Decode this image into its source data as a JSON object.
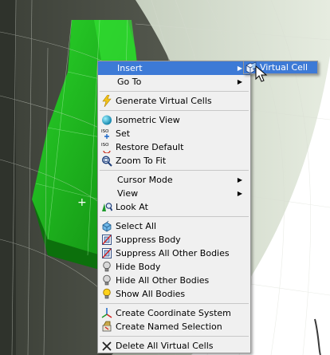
{
  "menu": {
    "items": [
      {
        "label": "Insert",
        "submenu": true,
        "highlighted": true
      },
      {
        "label": "Go To",
        "submenu": true
      },
      {
        "separator": true
      },
      {
        "label": "Generate Virtual Cells",
        "icon": "lightning-icon"
      },
      {
        "separator": true
      },
      {
        "label": "Isometric View",
        "icon": "sphere-icon"
      },
      {
        "label": "Set",
        "icon": "iso-set-icon"
      },
      {
        "label": "Restore Default",
        "icon": "iso-restore-icon"
      },
      {
        "label": "Zoom To Fit",
        "icon": "zoom-fit-icon"
      },
      {
        "separator": true
      },
      {
        "label": "Cursor Mode",
        "submenu": true
      },
      {
        "label": "View",
        "submenu": true
      },
      {
        "label": "Look At",
        "icon": "look-at-icon"
      },
      {
        "separator": true
      },
      {
        "label": "Select All",
        "icon": "select-all-icon"
      },
      {
        "label": "Suppress Body",
        "icon": "suppress-body-icon"
      },
      {
        "label": "Suppress All Other Bodies",
        "icon": "suppress-others-icon"
      },
      {
        "label": "Hide Body",
        "icon": "bulb-grey-icon"
      },
      {
        "label": "Hide All Other Bodies",
        "icon": "bulb-grey-icon"
      },
      {
        "label": "Show All Bodies",
        "icon": "bulb-yellow-icon"
      },
      {
        "separator": true
      },
      {
        "label": "Create Coordinate System",
        "icon": "coordinate-system-icon"
      },
      {
        "label": "Create Named Selection",
        "icon": "named-selection-icon"
      },
      {
        "separator": true
      },
      {
        "label": "Delete All Virtual Cells",
        "icon": "delete-x-icon"
      }
    ]
  },
  "submenu": {
    "label": "Virtual Cell",
    "icon": "virtual-cell-icon"
  },
  "iso_text": "ISO",
  "colors": {
    "highlight": "#3d7ad6",
    "menu_bg": "#f0f0f0",
    "body_green": "#22b422",
    "background_grey": "#4e5448"
  }
}
